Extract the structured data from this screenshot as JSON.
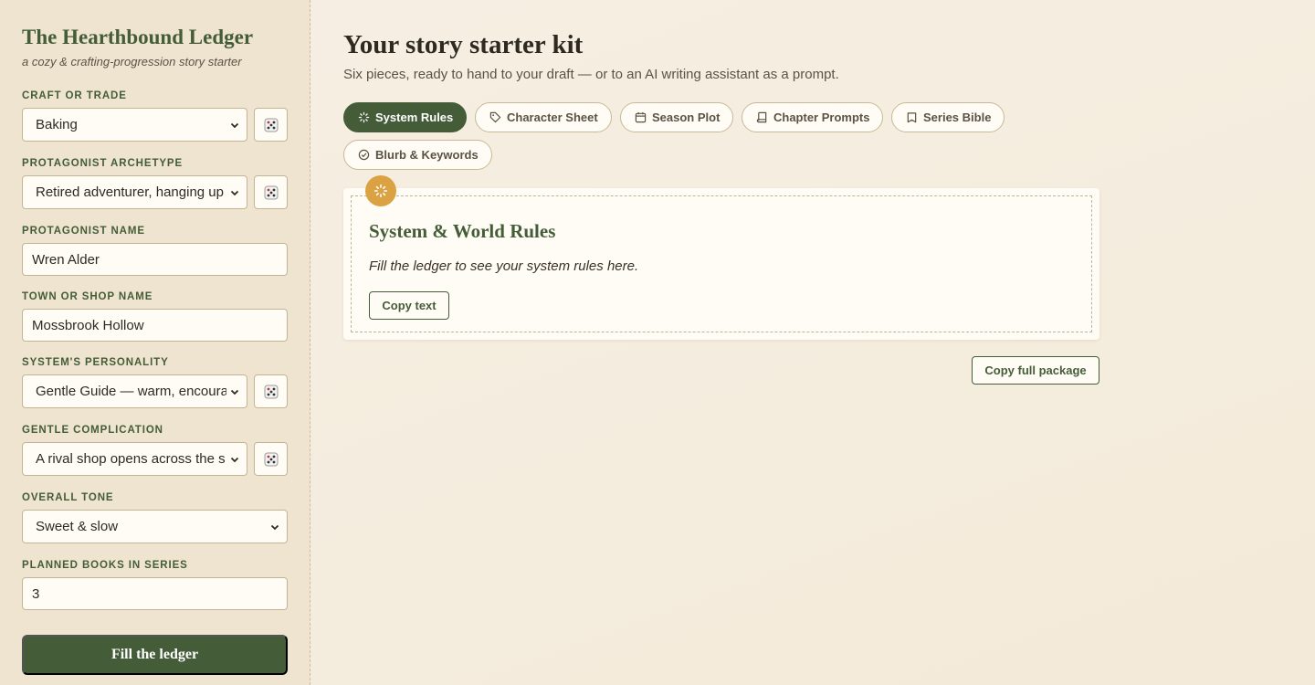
{
  "sidebar": {
    "title": "The Hearthbound Ledger",
    "subtitle": "a cozy & crafting-progression story starter",
    "fields": {
      "craft": {
        "label": "Craft or Trade",
        "value": "Baking"
      },
      "archetype": {
        "label": "Protagonist Archetype",
        "value": "Retired adventurer, hanging up"
      },
      "name": {
        "label": "Protagonist Name",
        "value": "Wren Alder"
      },
      "town": {
        "label": "Town or Shop Name",
        "value": "Mossbrook Hollow"
      },
      "personality": {
        "label": "System's Personality",
        "value": "Gentle Guide — warm, encoura"
      },
      "complication": {
        "label": "Gentle Complication",
        "value": "A rival shop opens across the s"
      },
      "tone": {
        "label": "Overall Tone",
        "value": "Sweet & slow"
      },
      "books": {
        "label": "Planned Books in Series",
        "value": "3"
      }
    },
    "fill_button": "Fill the ledger"
  },
  "main": {
    "title": "Your story starter kit",
    "subtitle": "Six pieces, ready to hand to your draft — or to an AI writing assistant as a prompt.",
    "tabs": [
      {
        "label": "System Rules",
        "icon": "spinner-icon",
        "active": true
      },
      {
        "label": "Character Sheet",
        "icon": "tag-icon",
        "active": false
      },
      {
        "label": "Season Plot",
        "icon": "calendar-icon",
        "active": false
      },
      {
        "label": "Chapter Prompts",
        "icon": "book-icon",
        "active": false
      },
      {
        "label": "Series Bible",
        "icon": "open-book-icon",
        "active": false
      },
      {
        "label": "Blurb & Keywords",
        "icon": "check-circle-icon",
        "active": false
      }
    ],
    "card": {
      "title": "System & World Rules",
      "text": "Fill the ledger to see your system rules here.",
      "copy_button": "Copy text"
    },
    "copy_full_button": "Copy full package"
  },
  "colors": {
    "accent": "#445d38",
    "badge": "#dba243",
    "sidebar_bg": "#efe4d0",
    "page_bg": "#f6efe3"
  }
}
